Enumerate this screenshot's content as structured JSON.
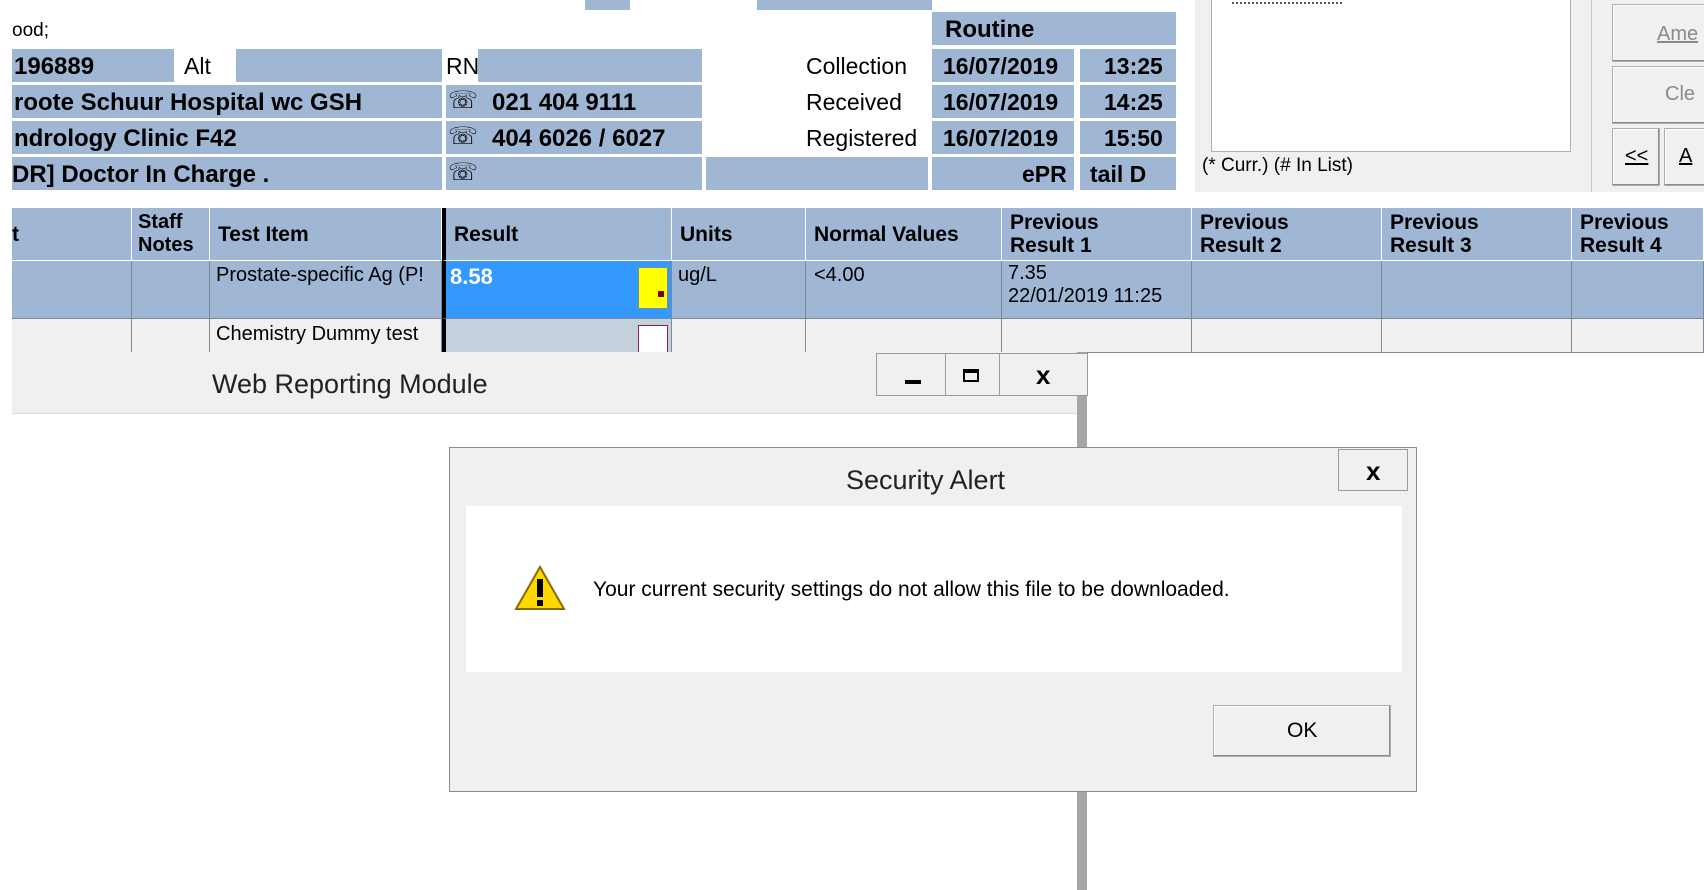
{
  "patient_header": {
    "specimen_line": "ood;",
    "id_number": "196889",
    "alt_label": "Alt",
    "rn_label": "RN",
    "hospital": "roote Schuur Hospital wc GSH",
    "clinic": "ndrology Clinic F42",
    "doctor": "DR] Doctor In Charge .",
    "phone_1": "021 404 9111",
    "phone_2": "404 6026 / 6027",
    "priority": "Routine",
    "collection_label": "Collection",
    "collection_date": "16/07/2019",
    "collection_time": "13:25",
    "received_label": "Received",
    "received_date": "16/07/2019",
    "received_time": "14:25",
    "registered_label": "Registered",
    "registered_date": "16/07/2019",
    "registered_time": "15:50",
    "epr_label": "ePR",
    "tail_label": "tail D"
  },
  "list_panel": {
    "legend": "(* Curr.)  (# In List)"
  },
  "right_buttons": {
    "amend": "Ame",
    "clear": "Cle",
    "prev": "<<",
    "next": "A"
  },
  "results_table": {
    "headers": {
      "col0": "t",
      "staff_notes_1": "Staff",
      "staff_notes_2": "Notes",
      "test_item": "Test Item",
      "result": "Result",
      "units": "Units",
      "normal_values": "Normal Values",
      "prev1_a": "Previous",
      "prev1_b": "Result 1",
      "prev2_a": "Previous",
      "prev2_b": "Result 2",
      "prev3_a": "Previous",
      "prev3_b": "Result 3",
      "prev4_a": "Previous",
      "prev4_b": "Result 4"
    },
    "rows": [
      {
        "test_item": "Prostate-specific Ag (P!",
        "result": "8.58",
        "units": "ug/L",
        "normal_values": "<4.00",
        "prev1_value": "7.35",
        "prev1_datetime": "22/01/2019 11:25"
      },
      {
        "test_item": "Chemistry Dummy test",
        "result": "",
        "units": "",
        "normal_values": "",
        "prev1_value": "",
        "prev1_datetime": ""
      }
    ]
  },
  "web_module_window": {
    "title": "Web Reporting Module"
  },
  "security_alert": {
    "title": "Security Alert",
    "message": "Your current security settings do not allow this file to be downloaded.",
    "ok_label": "OK"
  },
  "colors": {
    "cell_blue": "#9fb7d4",
    "selection_blue": "#3399ff",
    "flag_yellow": "#ffff00"
  }
}
